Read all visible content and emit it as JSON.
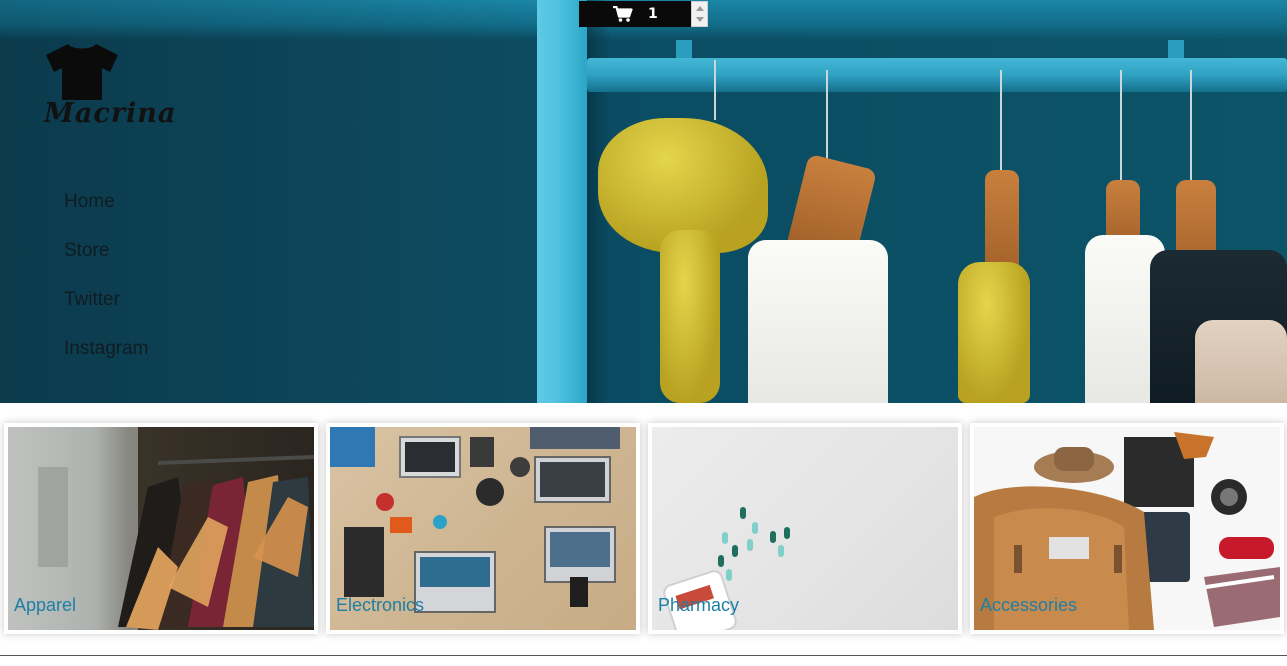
{
  "cart": {
    "count": "1",
    "icon": "shopping-cart-icon"
  },
  "brand": {
    "name": "Macrina",
    "icon": "t-shirt-icon"
  },
  "nav": {
    "items": [
      {
        "label": "Home"
      },
      {
        "label": "Store"
      },
      {
        "label": "Twitter"
      },
      {
        "label": "Instagram"
      }
    ]
  },
  "categories": [
    {
      "label": "Apparel"
    },
    {
      "label": "Electronics"
    },
    {
      "label": "Pharmacy"
    },
    {
      "label": "Accessories"
    }
  ],
  "colors": {
    "accent": "#1e7fa4",
    "hero_bg": "#0e4a5f",
    "cart_bar": "#0a0a0a"
  }
}
